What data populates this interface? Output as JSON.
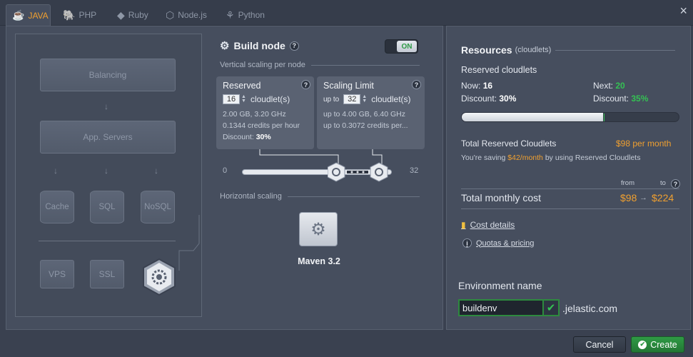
{
  "tabs": [
    {
      "label": "JAVA",
      "icon": "java-icon",
      "active": true
    },
    {
      "label": "PHP",
      "icon": "php-icon"
    },
    {
      "label": "Ruby",
      "icon": "ruby-icon"
    },
    {
      "label": "Node.js",
      "icon": "nodejs-icon"
    },
    {
      "label": "Python",
      "icon": "python-icon"
    }
  ],
  "close_icon": "×",
  "topology": {
    "balancing": "Balancing",
    "app_servers": "App. Servers",
    "cache": "Cache",
    "sql": "SQL",
    "nosql": "NoSQL",
    "vps": "VPS",
    "ssl": "SSL"
  },
  "build_node": {
    "title": "Build node",
    "toggle": "ON",
    "vertical_label": "Vertical scaling per node",
    "reserved": {
      "title": "Reserved",
      "value": "16",
      "unit": "cloudlet(s)",
      "line1": "2.00 GB, 3.20 GHz",
      "line2": "0.1344 credits per hour",
      "discount_label": "Discount:",
      "discount_value": "30%"
    },
    "limit": {
      "title": "Scaling Limit",
      "prefix": "up to",
      "value": "32",
      "unit": "cloudlet(s)",
      "line1_prefix": "up to",
      "line1": "4.00 GB, 6.40 GHz",
      "line2_prefix": "up to",
      "line2": "0.3072 credits per..."
    },
    "slider": {
      "min": "0",
      "max": "32",
      "reserved": 16,
      "limit": 32
    },
    "horizontal_label": "Horizontal scaling",
    "stack_name": "Maven 3.2"
  },
  "resources": {
    "title": "Resources",
    "subtitle": "(cloudlets)",
    "reserved_label": "Reserved cloudlets",
    "now_label": "Now:",
    "now_value": "16",
    "next_label": "Next:",
    "next_value": "20",
    "discount_label": "Discount:",
    "discount_now": "30%",
    "discount_next": "35%",
    "bar_fill_fraction": 0.65,
    "total_reserved_label": "Total Reserved Cloudlets",
    "total_reserved_value": "$98 per month",
    "saving_prefix": "You're saving",
    "saving_value": "$42/month",
    "saving_suffix": "by using Reserved Cloudlets",
    "from_label": "from",
    "to_label": "to",
    "monthly_label": "Total monthly cost",
    "cost_from": "$98",
    "cost_to": "$224",
    "cost_details": "Cost details",
    "quotas": "Quotas & pricing"
  },
  "environment": {
    "label": "Environment name",
    "value": "buildenv",
    "domain": ".jelastic.com"
  },
  "footer": {
    "cancel": "Cancel",
    "create": "Create"
  },
  "colors": {
    "accent_orange": "#f0a030",
    "green": "#34c153",
    "panel": "#464e5e",
    "background": "#3a4150"
  }
}
